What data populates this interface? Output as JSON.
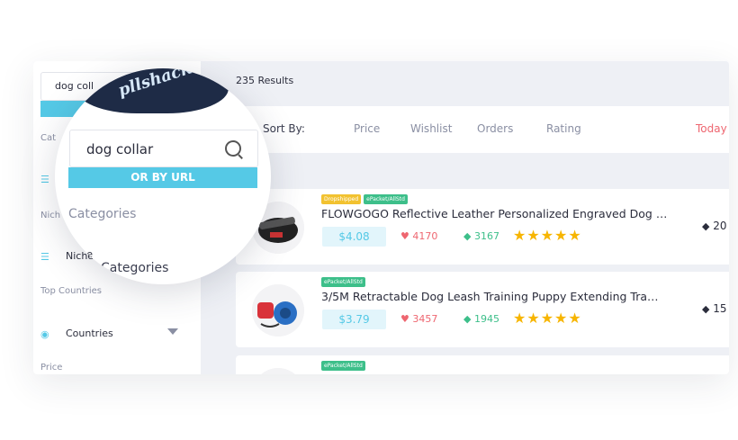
{
  "sidebar": {
    "search_value": "dog coll",
    "label_categories": "Cat",
    "row_categories_icon": "list-icon",
    "label_niche": "Nich",
    "row_niche": "Niche",
    "label_top_countries": "Top Countries",
    "row_countries": "Countries",
    "label_price": "Price"
  },
  "results": {
    "count_text": "235 Results"
  },
  "sort": {
    "label": "Sort By:",
    "options": [
      "Price",
      "Wishlist",
      "Orders",
      "Rating",
      "Today"
    ]
  },
  "products": [
    {
      "badges": [
        "Dropshipped",
        "ePacket/AllStd"
      ],
      "title": "FLOWGOGO Reflective Leather Personalized Engraved Dog …",
      "price": "$4.08",
      "wishlist": "4170",
      "orders": "3167",
      "rating": 5,
      "side_value": "20"
    },
    {
      "badges": [
        "ePacket/AllStd"
      ],
      "title": "3/5M Retractable Dog Leash Training Puppy Extending Tra…",
      "price": "$3.79",
      "wishlist": "3457",
      "orders": "1945",
      "rating": 5,
      "side_value": "15"
    },
    {
      "badges": [
        "ePacket/AllStd"
      ]
    }
  ],
  "magnifier": {
    "logo_text": "pllshack",
    "search_value": "dog collar",
    "url_button": "OR BY URL",
    "categories_muted": "Categories",
    "niche_label": "Niche",
    "categories_bold": "Categories"
  },
  "colors": {
    "accent": "#55c9e6",
    "wishlist": "#ee6670",
    "orders": "#3dbf8a",
    "star": "#f7b500",
    "today": "#ee6670"
  }
}
